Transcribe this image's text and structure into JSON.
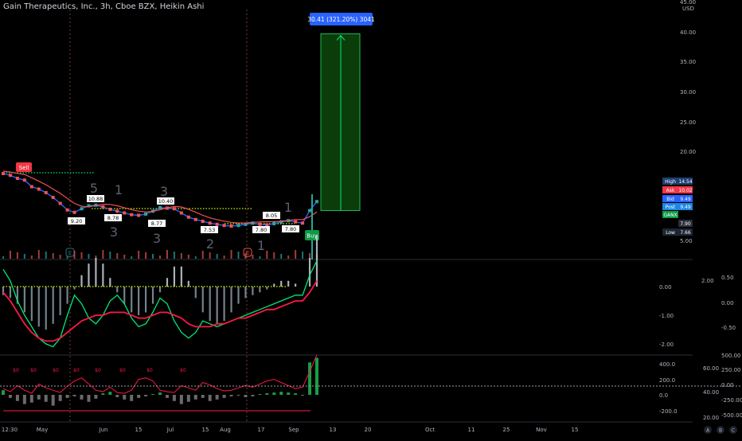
{
  "header": {
    "title": "Gain Therapeutics, Inc., 3h, Cboe BZX, Heikin Ashi"
  },
  "colors": {
    "bg": "#000000",
    "up": "#26a69a",
    "down": "#ef5350",
    "red": "#ff1744",
    "green": "#00e676",
    "blue": "#2196f3",
    "ask": "#f23645",
    "bid": "#2962ff",
    "target_zone": "#0b3d0b"
  },
  "chart_data": [
    {
      "type": "line",
      "price_scale": {
        "currency": "USD",
        "ticks": [
          "45.00",
          "40.00",
          "35.00",
          "30.00",
          "25.00",
          "20.00",
          "5.00"
        ]
      },
      "ylim": [
        0,
        45
      ],
      "x_labels": [
        "12:30",
        "May",
        "Jun",
        "15",
        "Jul",
        "15",
        "Aug",
        "17",
        "Sep",
        "13",
        "20",
        "Oct",
        "11",
        "25",
        "Nov",
        "15"
      ],
      "price": [
        16.2,
        15.9,
        15.4,
        15.1,
        14.0,
        13.6,
        13.0,
        12.2,
        11.2,
        10.1,
        9.7,
        10.3,
        10.8,
        10.9,
        10.6,
        10.2,
        9.9,
        9.6,
        9.3,
        9.2,
        9.4,
        9.9,
        10.5,
        10.4,
        10.3,
        9.6,
        8.9,
        8.5,
        8.2,
        7.9,
        7.7,
        7.5,
        7.4,
        7.5,
        7.7,
        7.9,
        7.7,
        7.6,
        7.8,
        8.1,
        8.3,
        8.1,
        7.9,
        10.0,
        11.5
      ],
      "price_labels": [
        "10.88",
        "9.20",
        "8.78",
        "10.40",
        "8.77",
        "7.53",
        "7.80",
        "8.05",
        "7.80"
      ],
      "markers": {
        "sell": "Sell",
        "buy": "Buy"
      },
      "wave_labels": [
        "5",
        "1",
        "3",
        "3",
        "3",
        "2",
        "1",
        "1"
      ],
      "earnings": "E",
      "target": {
        "label": "30.41 (321.20%) 3041",
        "target_price": 39.6,
        "entry_price": 10.0
      },
      "quote": [
        {
          "key": "High",
          "value": "14.54"
        },
        {
          "key": "Ask",
          "value": "10.02"
        },
        {
          "key": "Bid",
          "value": "9.49"
        },
        {
          "key": "Post",
          "value": "9.49"
        },
        {
          "key": "GANX",
          "value": ""
        },
        {
          "key": "",
          "value": "7.90"
        },
        {
          "key": "Low",
          "value": "7.66"
        }
      ]
    },
    {
      "type": "line",
      "name": "oscillator",
      "ticks_inner": [
        "0.00",
        "-1.00",
        "-2.00"
      ],
      "ticks_outer": [
        "2.00",
        "0.50",
        "0.00",
        "-0.50"
      ],
      "histogram": [
        -0.3,
        -0.4,
        -0.6,
        -0.9,
        -1.2,
        -1.4,
        -1.5,
        -1.3,
        -1.0,
        -0.6,
        -0.1,
        0.4,
        0.8,
        1.0,
        0.8,
        0.3,
        -0.2,
        -0.6,
        -0.9,
        -1.0,
        -0.9,
        -0.6,
        -0.2,
        0.3,
        0.7,
        0.7,
        0.2,
        -0.4,
        -0.9,
        -1.2,
        -1.3,
        -1.2,
        -0.9,
        -0.6,
        -0.4,
        -0.3,
        -0.2,
        -0.1,
        0.1,
        0.2,
        0.2,
        0.1,
        0.0,
        1.0,
        1.8
      ],
      "fast": [
        0.6,
        0.2,
        -0.5,
        -1.0,
        -1.4,
        -1.8,
        -2.0,
        -2.1,
        -1.8,
        -1.0,
        -0.3,
        -0.6,
        -1.1,
        -1.3,
        -1.0,
        -0.5,
        -0.3,
        -0.6,
        -1.1,
        -1.4,
        -1.3,
        -0.9,
        -0.4,
        -0.6,
        -1.2,
        -1.6,
        -1.8,
        -1.6,
        -1.2,
        -1.3,
        -1.4,
        -1.3,
        -1.2,
        -1.1,
        -1.0,
        -0.9,
        -0.8,
        -0.7,
        -0.6,
        -0.5,
        -0.4,
        -0.3,
        -0.3,
        0.4,
        0.9
      ],
      "slow": [
        -0.2,
        -0.5,
        -0.9,
        -1.3,
        -1.6,
        -1.8,
        -1.9,
        -1.9,
        -1.8,
        -1.6,
        -1.4,
        -1.2,
        -1.1,
        -1.0,
        -1.0,
        -0.9,
        -0.9,
        -0.9,
        -1.0,
        -1.1,
        -1.1,
        -1.0,
        -0.9,
        -0.9,
        -1.0,
        -1.1,
        -1.3,
        -1.4,
        -1.4,
        -1.4,
        -1.3,
        -1.3,
        -1.2,
        -1.1,
        -1.1,
        -1.0,
        -0.9,
        -0.8,
        -0.8,
        -0.7,
        -0.6,
        -0.5,
        -0.5,
        -0.2,
        0.2
      ]
    },
    {
      "type": "bar",
      "name": "volume-flow",
      "ticks_inner": [
        "400.0",
        "200.0",
        "0.0",
        "-200.0"
      ],
      "ticks_mid": [
        "60.00",
        "40.00",
        "20.00"
      ],
      "ticks_outer": [
        "500.00",
        "250.00",
        "0.00",
        "-250.00",
        "-500.00"
      ],
      "values": [
        60,
        -40,
        -80,
        -120,
        -100,
        -60,
        -90,
        -140,
        -80,
        -40,
        -20,
        -60,
        -90,
        -50,
        20,
        40,
        -30,
        -60,
        -80,
        -40,
        -20,
        10,
        30,
        -40,
        -80,
        -120,
        -90,
        -60,
        -40,
        -80,
        -60,
        -40,
        -20,
        -10,
        -30,
        -20,
        10,
        20,
        30,
        40,
        30,
        20,
        -10,
        420,
        480
      ],
      "line": [
        80,
        40,
        120,
        60,
        20,
        140,
        90,
        60,
        30,
        110,
        180,
        220,
        140,
        60,
        40,
        100,
        30,
        20,
        60,
        200,
        220,
        180,
        60,
        40,
        30,
        120,
        90,
        60,
        160,
        130,
        80,
        50,
        60,
        90,
        120,
        100,
        140,
        180,
        200,
        160,
        120,
        80,
        100,
        300,
        520
      ],
      "signals": [
        "$0",
        "$0",
        "$0",
        "$0",
        "$0",
        "$0",
        "$0",
        "$0"
      ]
    }
  ],
  "footer": {
    "icons": [
      "A",
      "B",
      "C"
    ]
  }
}
